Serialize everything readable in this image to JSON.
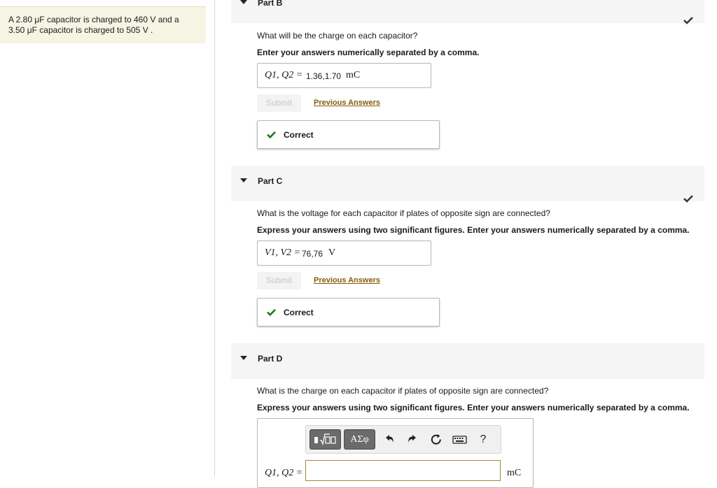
{
  "problem": {
    "line1": "A 2.80 μF capacitor is charged to 460 V and a",
    "line2": "3.50 μF capacitor is charged to 505 V ."
  },
  "parts": [
    {
      "title": "Part B",
      "question": "What will be the charge on each capacitor?",
      "instruction": "Enter your answers numerically separated by a comma.",
      "answer_label": "Q1, Q2 =",
      "answer_value": "1.36,1.70",
      "answer_unit": "mC",
      "submit_label": "Submit",
      "previous_label": "Previous Answers",
      "feedback": "Correct"
    },
    {
      "title": "Part C",
      "question": "What is the voltage for each capacitor if plates of opposite sign are connected?",
      "instruction": "Express your answers using two significant figures. Enter your answers numerically separated by a comma.",
      "answer_label": "V1, V2 =",
      "answer_value": "76,76",
      "answer_unit": "V",
      "submit_label": "Submit",
      "previous_label": "Previous Answers",
      "feedback": "Correct"
    },
    {
      "title": "Part D",
      "question": "What is the charge on each capacitor if plates of opposite sign are connected?",
      "instruction": "Express your answers using two significant figures. Enter your answers numerically separated by a comma.",
      "answer_label": "Q1, Q2 =",
      "answer_unit": "mC",
      "toolbar": {
        "greek_label": "ΑΣφ",
        "help_label": "?"
      }
    }
  ],
  "colors": {
    "correct_green": "#1f7a1f",
    "link_brown": "#8a5a0a",
    "problem_bg": "#f6f4e3"
  }
}
